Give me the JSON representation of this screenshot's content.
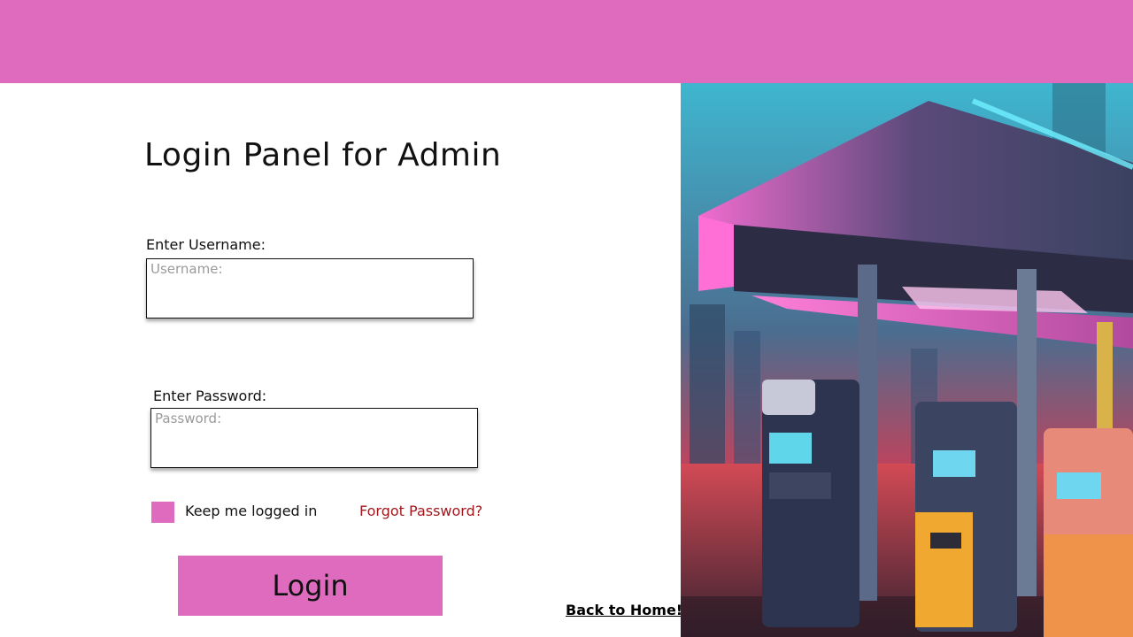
{
  "page": {
    "title": "Login Panel for Admin"
  },
  "form": {
    "username_label": "Enter Username:",
    "username_placeholder": "Username:",
    "username_value": "",
    "password_label": "Enter Password:",
    "password_placeholder": "Password:",
    "password_value": "",
    "keep_logged_in_label": "Keep me logged in",
    "keep_logged_in_checked": false,
    "forgot_password_label": "Forgot Password?",
    "login_button_label": "Login"
  },
  "nav": {
    "back_home_label": "Back to Home!"
  },
  "image": {
    "description_name": "neon-gas-station-illustration"
  },
  "colors": {
    "accent": "#de6bbd",
    "forgot_link": "#a0191e"
  }
}
